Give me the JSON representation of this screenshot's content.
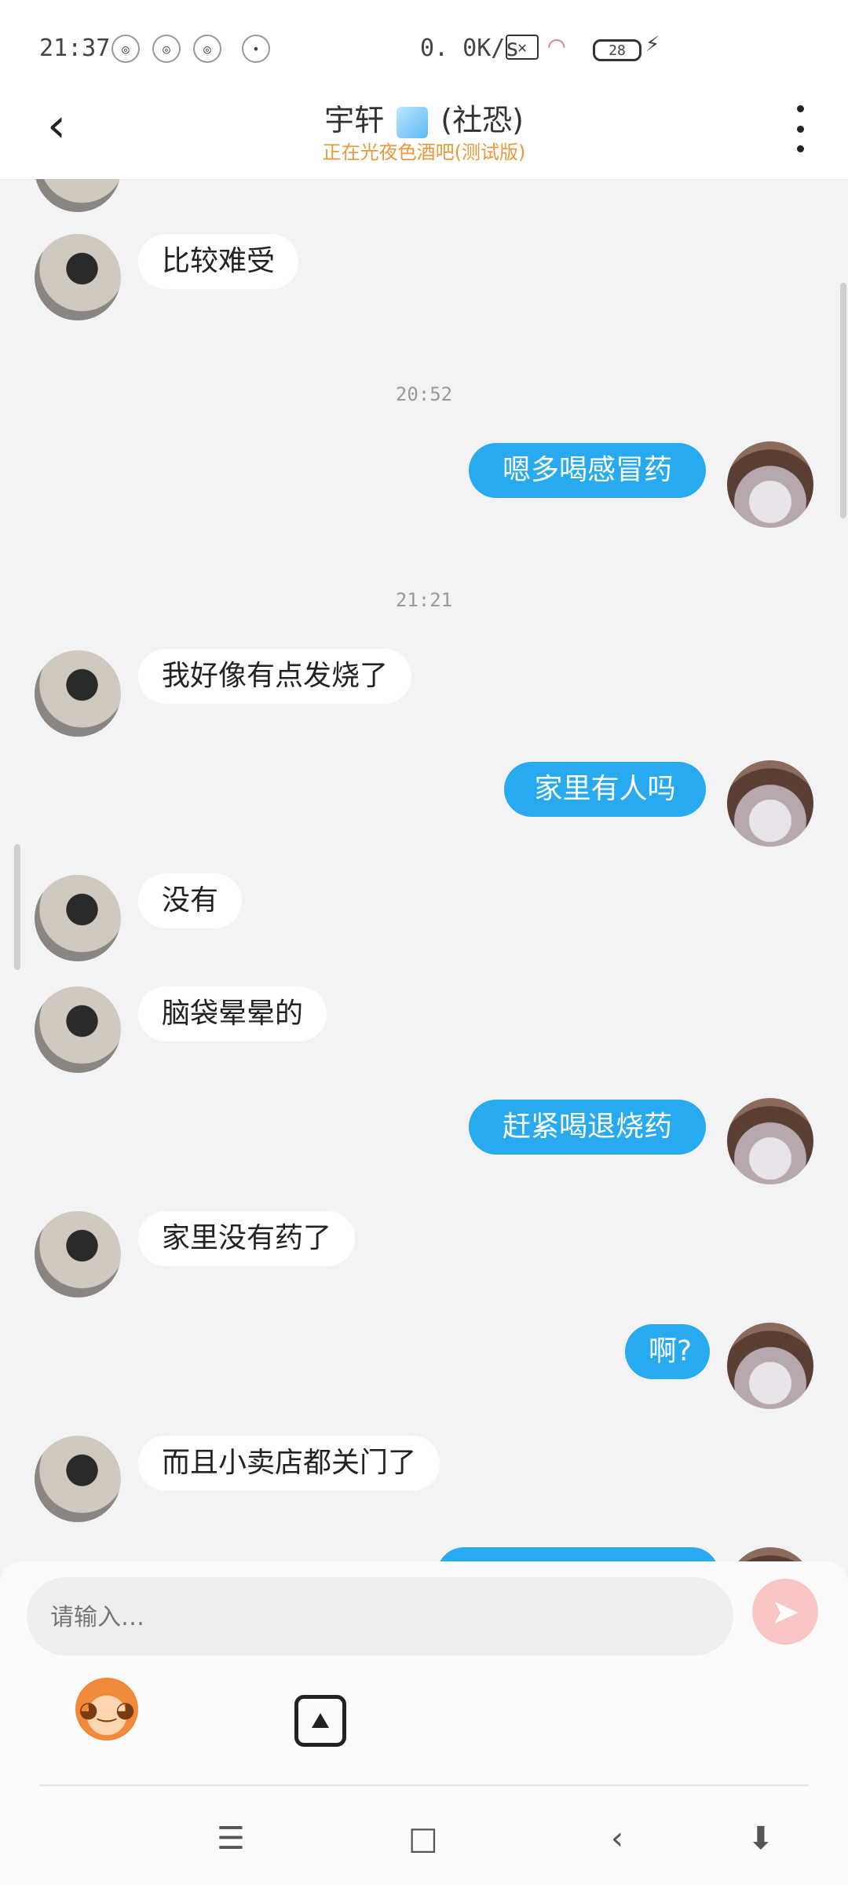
{
  "status_bar": {
    "time": "21:37",
    "network_speed": "0. 0K/s",
    "battery_level": "28",
    "dot": "•",
    "signal_symbol": "✕"
  },
  "header": {
    "title_left": "宇轩",
    "title_right": "(社恐)",
    "subtitle": "正在光夜色酒吧(测试版)",
    "back_symbol": "‹"
  },
  "messages": [
    {
      "side": "other",
      "text": "比较难受"
    },
    {
      "side": "time",
      "text": "20:52"
    },
    {
      "side": "me",
      "text": "嗯多喝感冒药"
    },
    {
      "side": "time",
      "text": "21:21"
    },
    {
      "side": "other",
      "text": "我好像有点发烧了"
    },
    {
      "side": "me",
      "text": "家里有人吗"
    },
    {
      "side": "other",
      "text": "没有"
    },
    {
      "side": "other",
      "text": "脑袋晕晕的"
    },
    {
      "side": "me",
      "text": "赶紧喝退烧药"
    },
    {
      "side": "other",
      "text": "家里没有药了"
    },
    {
      "side": "me",
      "text": "啊?"
    },
    {
      "side": "other",
      "text": "而且小卖店都关门了"
    }
  ],
  "input": {
    "placeholder": "请输入…",
    "send_symbol": "➤"
  },
  "icons": {
    "back": "back-arrow-icon",
    "more": "more-vertical-icon",
    "emoji": "emoji-mascot-icon",
    "image": "image-picker-icon",
    "send": "send-paper-plane-icon"
  },
  "nav": {
    "menu": "☰",
    "home": "□",
    "back": "‹",
    "assist": "⬇"
  }
}
